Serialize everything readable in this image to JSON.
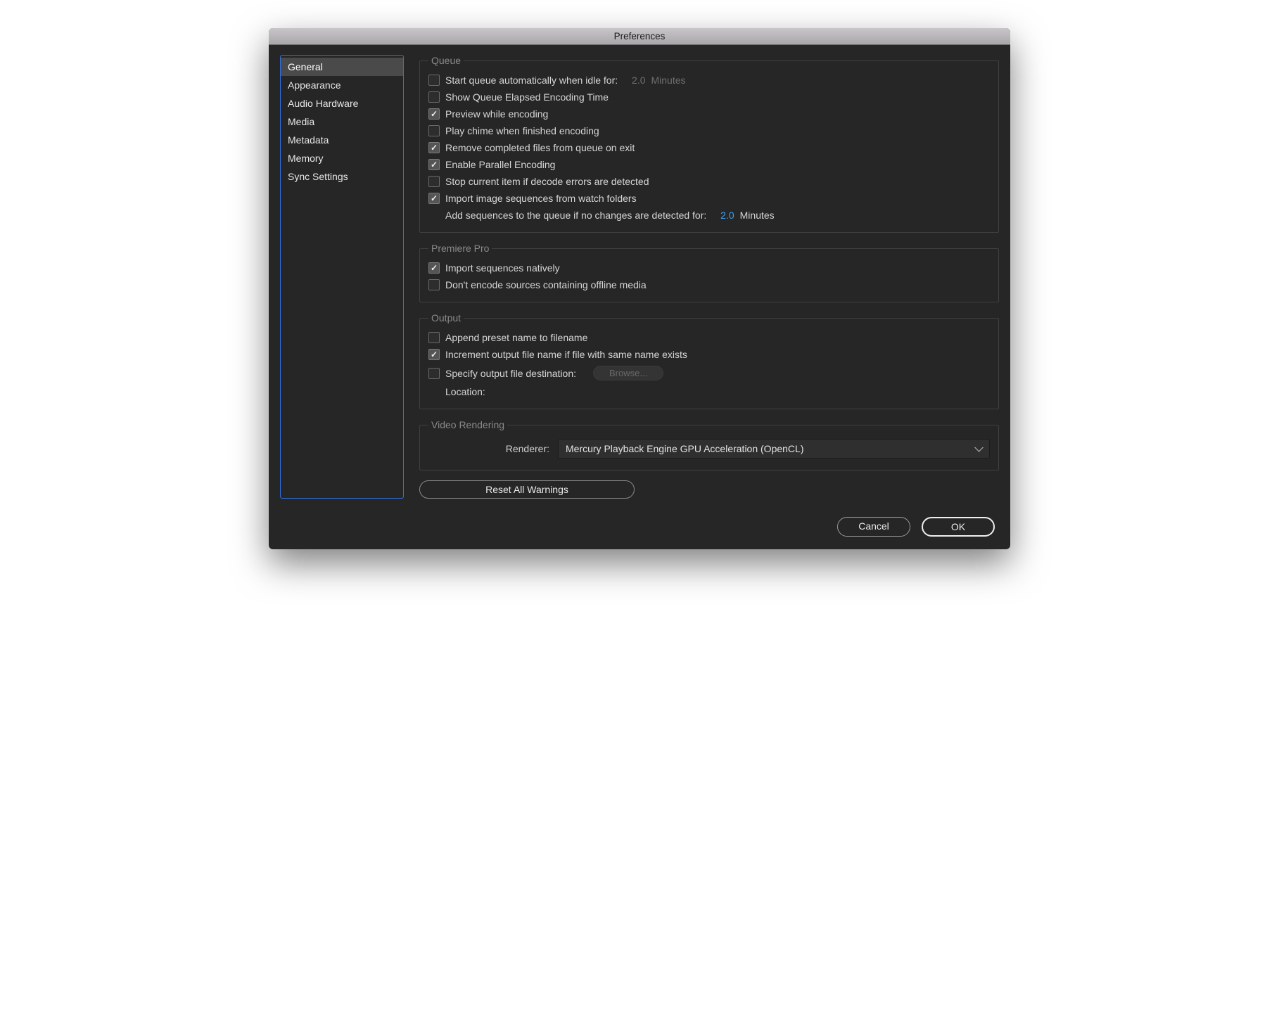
{
  "title": "Preferences",
  "sidebar": {
    "items": [
      {
        "label": "General",
        "active": true
      },
      {
        "label": "Appearance",
        "active": false
      },
      {
        "label": "Audio Hardware",
        "active": false
      },
      {
        "label": "Media",
        "active": false
      },
      {
        "label": "Metadata",
        "active": false
      },
      {
        "label": "Memory",
        "active": false
      },
      {
        "label": "Sync Settings",
        "active": false
      }
    ]
  },
  "groups": {
    "queue": {
      "legend": "Queue",
      "startAuto": {
        "label": "Start queue automatically when idle for:",
        "checked": false,
        "value": "2.0",
        "unit": "Minutes"
      },
      "showElapsed": {
        "label": "Show Queue Elapsed Encoding Time",
        "checked": false
      },
      "preview": {
        "label": "Preview while encoding",
        "checked": true
      },
      "playChime": {
        "label": "Play chime when finished encoding",
        "checked": false
      },
      "removeCompleted": {
        "label": "Remove completed files from queue on exit",
        "checked": true
      },
      "parallel": {
        "label": "Enable Parallel Encoding",
        "checked": true
      },
      "stopOnError": {
        "label": "Stop current item if decode errors are detected",
        "checked": false
      },
      "importImageSeq": {
        "label": "Import image sequences from watch folders",
        "checked": true
      },
      "addSequences": {
        "label": "Add sequences to the queue if no changes are detected for:",
        "value": "2.0",
        "unit": "Minutes"
      }
    },
    "premiere": {
      "legend": "Premiere Pro",
      "importNative": {
        "label": "Import sequences natively",
        "checked": true
      },
      "dontEncodeOffline": {
        "label": "Don't encode sources containing offline media",
        "checked": false
      }
    },
    "output": {
      "legend": "Output",
      "appendPreset": {
        "label": "Append preset name to filename",
        "checked": false
      },
      "increment": {
        "label": "Increment output file name if file with same name exists",
        "checked": true
      },
      "specifyDest": {
        "label": "Specify output file destination:",
        "checked": false,
        "browse": "Browse...",
        "locationLabel": "Location:"
      }
    },
    "video": {
      "legend": "Video Rendering",
      "rendererLabel": "Renderer:",
      "rendererValue": "Mercury Playback Engine GPU Acceleration (OpenCL)"
    }
  },
  "buttons": {
    "reset": "Reset All Warnings",
    "cancel": "Cancel",
    "ok": "OK"
  }
}
